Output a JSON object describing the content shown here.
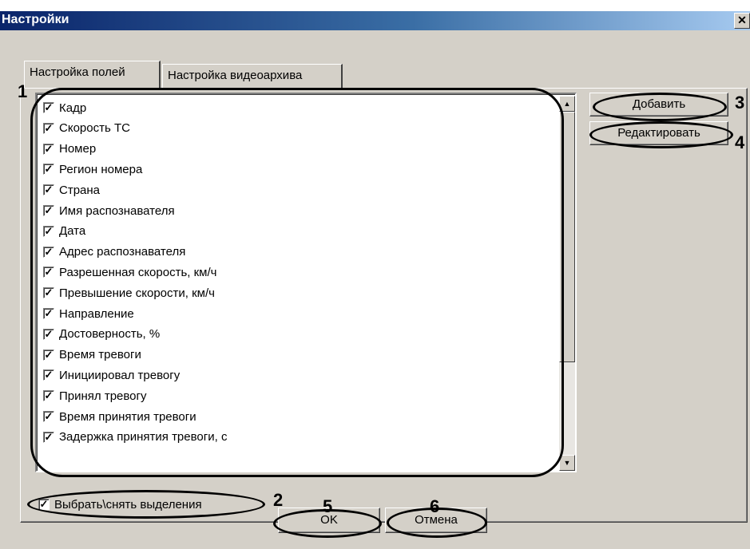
{
  "window": {
    "title": "Настройки",
    "close_glyph": "✕"
  },
  "tabs": [
    {
      "label": "Настройка полей",
      "active": true
    },
    {
      "label": "Настройка видеоархива",
      "active": false
    }
  ],
  "fields": [
    {
      "label": "Кадр",
      "checked": true
    },
    {
      "label": "Скорость ТС",
      "checked": true
    },
    {
      "label": "Номер",
      "checked": true
    },
    {
      "label": "Регион номера",
      "checked": true
    },
    {
      "label": "Страна",
      "checked": true
    },
    {
      "label": "Имя распознавателя",
      "checked": true
    },
    {
      "label": "Дата",
      "checked": true
    },
    {
      "label": "Адрес распознавателя",
      "checked": true
    },
    {
      "label": "Разрешенная скорость, км/ч",
      "checked": true
    },
    {
      "label": "Превышение скорости, км/ч",
      "checked": true
    },
    {
      "label": "Направление",
      "checked": true
    },
    {
      "label": "Достоверность, %",
      "checked": true
    },
    {
      "label": "Время тревоги",
      "checked": true
    },
    {
      "label": "Инициировал тревогу",
      "checked": true
    },
    {
      "label": "Принял тревогу",
      "checked": true
    },
    {
      "label": "Время принятия тревоги",
      "checked": true
    },
    {
      "label": "Задержка принятия тревоги, с",
      "checked": true
    }
  ],
  "buttons": {
    "add": "Добавить",
    "edit": "Редактировать",
    "ok": "OK",
    "cancel": "Отмена"
  },
  "select_all": {
    "label": "Выбрать\\снять  выделения",
    "checked": true
  },
  "check_glyph": "✓",
  "scroll_up_glyph": "▲",
  "scroll_down_glyph": "▼",
  "callouts": [
    "1",
    "2",
    "3",
    "4",
    "5",
    "6"
  ]
}
